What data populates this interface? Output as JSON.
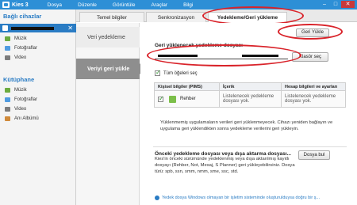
{
  "app": {
    "title": "Kies 3"
  },
  "menu": [
    "Dosya",
    "Düzenle",
    "Görüntüle",
    "Araçlar",
    "Bilgi"
  ],
  "window_controls": {
    "minimize": "–",
    "maximize": "□",
    "close": "✕"
  },
  "sidebar": {
    "connected_title": "Bağlı cihazlar",
    "device_close": "✕",
    "device_items": [
      {
        "label": "Müzik",
        "icon": "music-icon"
      },
      {
        "label": "Fotoğraflar",
        "icon": "photo-icon"
      },
      {
        "label": "Video",
        "icon": "video-icon"
      }
    ],
    "library_title": "Kütüphane",
    "library_items": [
      {
        "label": "Müzik",
        "icon": "music-icon"
      },
      {
        "label": "Fotoğraflar",
        "icon": "photo-icon"
      },
      {
        "label": "Video",
        "icon": "video-icon"
      },
      {
        "label": "Anı Albümü",
        "icon": "album-icon"
      }
    ]
  },
  "tabs": [
    "Temel bilgiler",
    "Senkronizasyon",
    "Yedekleme/Geri yükleme"
  ],
  "steps": {
    "backup": "Veri yedekleme",
    "restore": "Veriyi geri yükle"
  },
  "main": {
    "restore_button": "Geri Yükle",
    "restore_label": "Geri yüklenecek yedekleme dosyası",
    "folder_button": "Klasör seç",
    "select_all": "Tüm öğeleri seç",
    "table_headers": [
      "Kişisel bilgiler (PIMS)",
      "İçerik",
      "Hesap bilgileri ve ayarları"
    ],
    "row": {
      "name": "Rehber",
      "content": "Listelenecek yedekleme dosyası yok.",
      "account": "Listelenecek yedekleme dosyası yok."
    },
    "note": "Yüklenmemiş uygulamaların verileri geri yüklenmeyecek. Cihazı yeniden bağlayın ve uygulama geri yüklendikten sonra yedekleme verilerini geri yükleyin.",
    "older_title": "Önceki yedekleme dosyası veya dışa aktarma dosyası...",
    "find_button": "Dosya bul",
    "older_desc": "Kies'in önceki sürümünde yedeklenmiş veya dışa aktarılmış kayıtlı dosyayı (Rehber, Not, Mesaj, S Planner) geri yükleyebilirsiniz. Dosya türü: spb, ssn, smm, nmm, sme, ssc, std.",
    "footer_note": "Yedek dosya Windows olmayan bir işletim sisteminde oluşturulduysa doğru bir ş..."
  },
  "colors": {
    "accent": "#2a7cc4",
    "title_bar": "#2d8fd6",
    "annotation": "#d9232a"
  }
}
